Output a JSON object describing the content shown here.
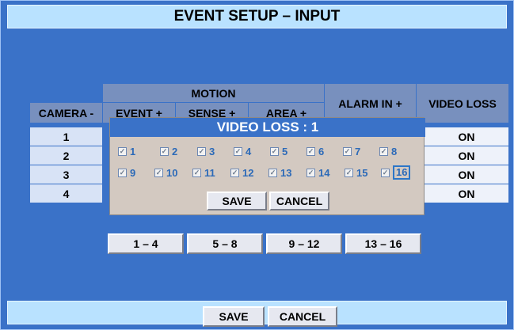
{
  "title": "EVENT SETUP – INPUT",
  "table": {
    "motion_header": "MOTION",
    "camera_header": "CAMERA -",
    "event_header": "EVENT +",
    "sense_header": "SENSE +",
    "area_header": "AREA +",
    "alarm_header": "ALARM IN +",
    "videoloss_header": "VIDEO LOSS",
    "rows": [
      {
        "camera": "1",
        "video_loss": "ON"
      },
      {
        "camera": "2",
        "video_loss": "ON"
      },
      {
        "camera": "3",
        "video_loss": "ON"
      },
      {
        "camera": "4",
        "video_loss": "ON"
      }
    ]
  },
  "popup": {
    "title": "VIDEO LOSS : 1",
    "checks_row1": [
      "1",
      "2",
      "3",
      "4",
      "5",
      "6",
      "7",
      "8"
    ],
    "checks_row2": [
      "9",
      "10",
      "11",
      "12",
      "13",
      "14",
      "15",
      "16"
    ],
    "check_mark": "✓",
    "save_label": "SAVE",
    "cancel_label": "CANCEL"
  },
  "pages": [
    "1 – 4",
    "5 – 8",
    "9 – 12",
    "13 – 16"
  ],
  "footer": {
    "save_label": "SAVE",
    "cancel_label": "CANCEL"
  }
}
